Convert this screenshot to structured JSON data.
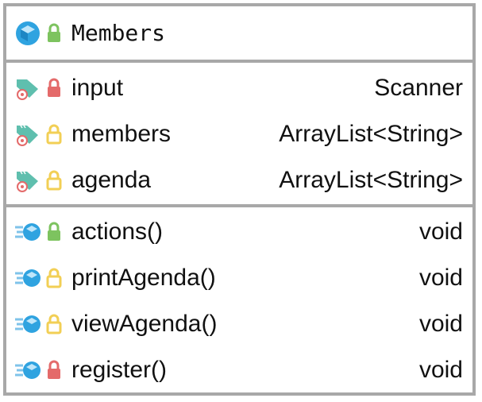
{
  "class": {
    "name": "Members",
    "icon": "class-icon",
    "visibility": "public"
  },
  "fields": [
    {
      "name": "input",
      "type": "Scanner",
      "visibility": "private",
      "icon": "field-icon"
    },
    {
      "name": "members",
      "type": "ArrayList<String>",
      "visibility": "package",
      "icon": "field-icon"
    },
    {
      "name": "agenda",
      "type": "ArrayList<String>",
      "visibility": "package",
      "icon": "field-icon"
    }
  ],
  "methods": [
    {
      "name": "actions()",
      "type": "void",
      "visibility": "public",
      "icon": "method-icon"
    },
    {
      "name": "printAgenda()",
      "type": "void",
      "visibility": "package",
      "icon": "method-icon"
    },
    {
      "name": "viewAgenda()",
      "type": "void",
      "visibility": "package",
      "icon": "method-icon"
    },
    {
      "name": "register()",
      "type": "void",
      "visibility": "private",
      "icon": "method-icon"
    }
  ],
  "colors": {
    "public": "#7dc35f",
    "private": "#e46a6a",
    "package": "#f2cf55",
    "border": "#a8a8a8",
    "class_icon": "#2fa3e0",
    "field_icon": "#5fbfae"
  }
}
